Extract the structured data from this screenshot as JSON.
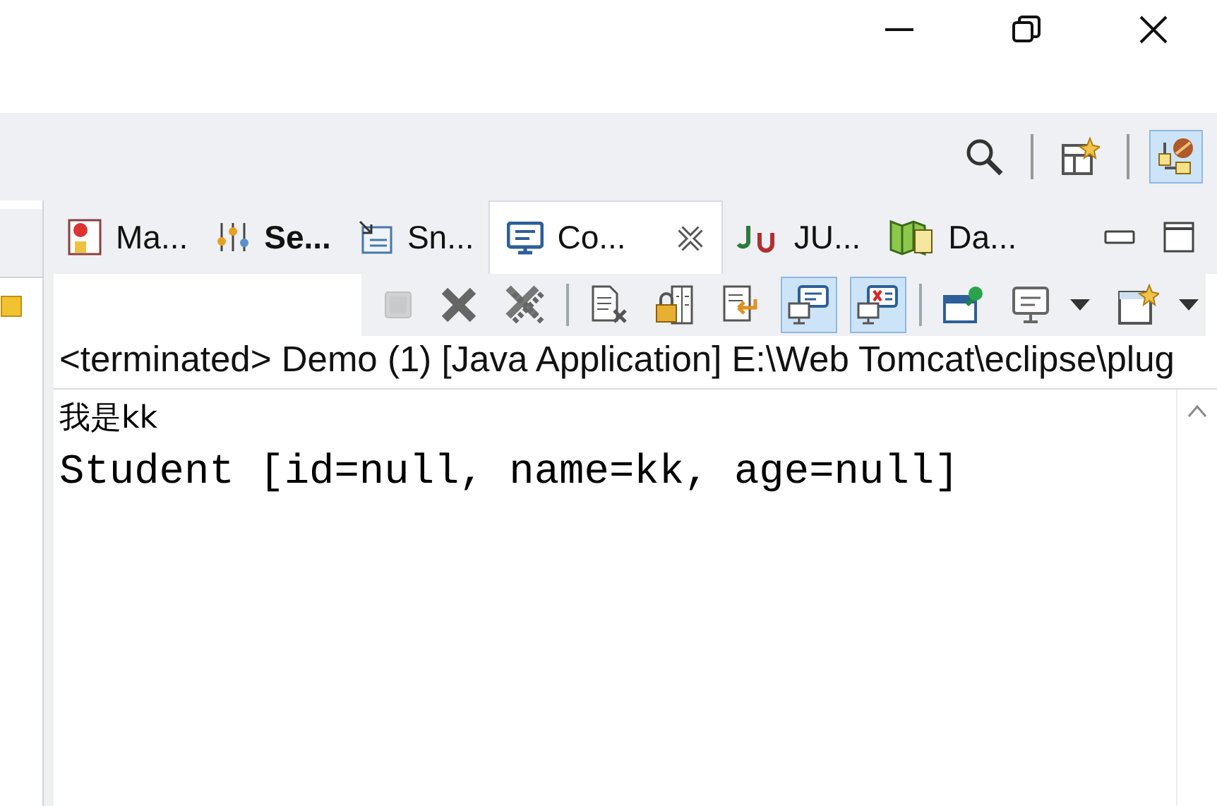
{
  "window": {
    "controls": [
      {
        "kind": "minimize"
      },
      {
        "kind": "restore"
      },
      {
        "kind": "close"
      }
    ]
  },
  "main_toolbar": {
    "items": [
      {
        "kind": "search",
        "selected": false
      },
      {
        "kind": "separator"
      },
      {
        "kind": "open-perspective",
        "selected": false
      },
      {
        "kind": "separator"
      },
      {
        "kind": "perspective",
        "selected": true
      }
    ]
  },
  "view_tabs": [
    {
      "kind": "markers",
      "label": "Ma...",
      "bold": false,
      "selected": false
    },
    {
      "kind": "servers",
      "label": "Se...",
      "bold": true,
      "selected": false
    },
    {
      "kind": "snippets",
      "label": "Sn...",
      "bold": false,
      "selected": false
    },
    {
      "kind": "console",
      "label": "Co...",
      "bold": false,
      "selected": true
    },
    {
      "kind": "junit",
      "label": "JU...",
      "bold": false,
      "selected": false
    },
    {
      "kind": "data",
      "label": "Da...",
      "bold": false,
      "selected": false
    }
  ],
  "console_toolbar": {
    "items": [
      {
        "kind": "terminate",
        "disabled": true,
        "pressed": false,
        "dropdown": false
      },
      {
        "kind": "remove",
        "disabled": false,
        "pressed": false,
        "dropdown": false
      },
      {
        "kind": "remove-all",
        "disabled": false,
        "pressed": false,
        "dropdown": false
      },
      {
        "kind": "separator"
      },
      {
        "kind": "clear",
        "disabled": false,
        "pressed": false,
        "dropdown": false
      },
      {
        "kind": "scroll-lock",
        "disabled": false,
        "pressed": false,
        "dropdown": false
      },
      {
        "kind": "word-wrap",
        "disabled": false,
        "pressed": false,
        "dropdown": false
      },
      {
        "kind": "show-output",
        "disabled": false,
        "pressed": true,
        "dropdown": false
      },
      {
        "kind": "show-error",
        "disabled": false,
        "pressed": true,
        "dropdown": false
      },
      {
        "kind": "separator"
      },
      {
        "kind": "pin",
        "disabled": false,
        "pressed": false,
        "dropdown": false
      },
      {
        "kind": "display",
        "disabled": false,
        "pressed": false,
        "dropdown": true
      },
      {
        "kind": "new-console",
        "disabled": false,
        "pressed": false,
        "dropdown": true
      }
    ]
  },
  "console": {
    "status": "<terminated> Demo (1) [Java Application] E:\\Web Tomcat\\eclipse\\plug",
    "lines": [
      "我是kk",
      "Student [id=null, name=kk, age=null]"
    ]
  }
}
